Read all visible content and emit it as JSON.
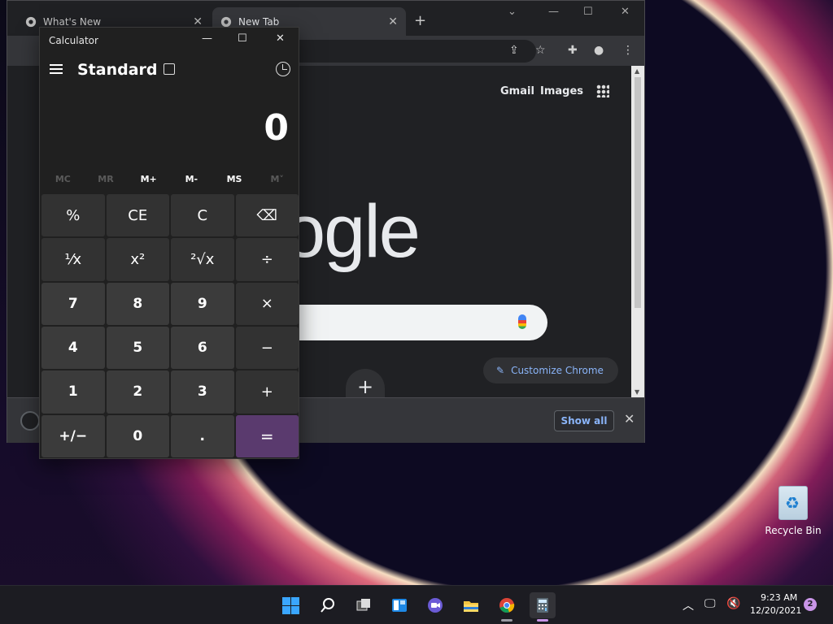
{
  "browser": {
    "tabs": [
      {
        "label": "What's New"
      },
      {
        "label": "New Tab"
      }
    ],
    "new_tab_icon": "plus-icon",
    "header_links": {
      "gmail": "Gmail",
      "images": "Images"
    },
    "logo_text": "ogle",
    "customize_label": "Customize Chrome",
    "download_bar": {
      "show_all": "Show all"
    }
  },
  "calculator": {
    "window_title": "Calculator",
    "mode": "Standard",
    "display_value": "0",
    "memory": [
      "MC",
      "MR",
      "M+",
      "M-",
      "MS",
      "M˅"
    ],
    "keys": [
      {
        "label": "%",
        "kind": "op"
      },
      {
        "label": "CE",
        "kind": "op"
      },
      {
        "label": "C",
        "kind": "op"
      },
      {
        "label": "⌫",
        "kind": "op"
      },
      {
        "label": "¹⁄x",
        "kind": "op"
      },
      {
        "label": "x²",
        "kind": "op"
      },
      {
        "label": "²√x",
        "kind": "op"
      },
      {
        "label": "÷",
        "kind": "op"
      },
      {
        "label": "7",
        "kind": "num"
      },
      {
        "label": "8",
        "kind": "num"
      },
      {
        "label": "9",
        "kind": "num"
      },
      {
        "label": "×",
        "kind": "op"
      },
      {
        "label": "4",
        "kind": "num"
      },
      {
        "label": "5",
        "kind": "num"
      },
      {
        "label": "6",
        "kind": "num"
      },
      {
        "label": "−",
        "kind": "op"
      },
      {
        "label": "1",
        "kind": "num"
      },
      {
        "label": "2",
        "kind": "num"
      },
      {
        "label": "3",
        "kind": "num"
      },
      {
        "label": "+",
        "kind": "op"
      },
      {
        "label": "+/−",
        "kind": "num"
      },
      {
        "label": "0",
        "kind": "num"
      },
      {
        "label": ".",
        "kind": "num"
      },
      {
        "label": "=",
        "kind": "eq"
      }
    ]
  },
  "desktop": {
    "recycle_bin_label": "Recycle Bin"
  },
  "taskbar": {
    "time": "9:23 AM",
    "date": "12/20/2021",
    "notification_count": "2"
  },
  "colors": {
    "calc_equals": "#5a3a6e",
    "accent": "#c995e8",
    "link": "#8ab4f8"
  }
}
